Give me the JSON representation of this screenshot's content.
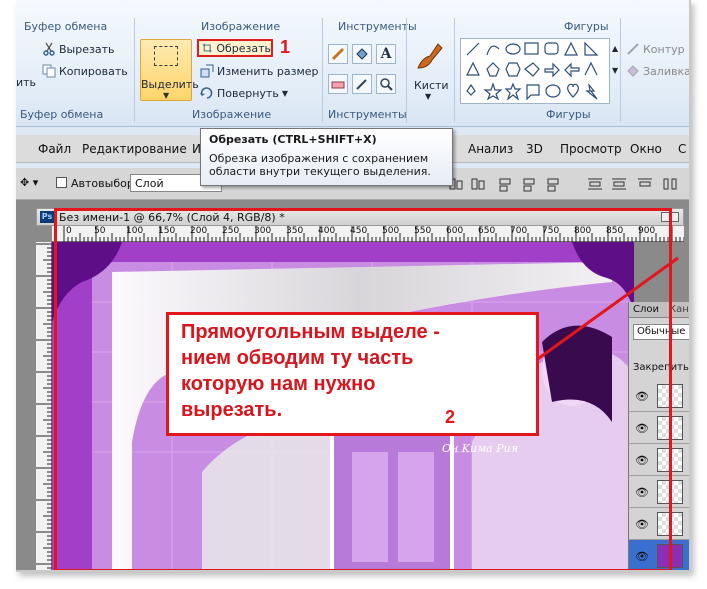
{
  "ribbon": {
    "groups": {
      "clipboard": "Буфер обмена",
      "image": "Изображение",
      "tools": "Инструменты",
      "shapes": "Фигуры"
    },
    "paste_partial": "ить",
    "cut_label": "Вырезать",
    "copy_label": "Копировать",
    "select_label": "Выделить",
    "crop_label": "Обрезать",
    "resize_label": "Изменить размер",
    "rotate_label": "Повернуть",
    "brushes_label": "Кисти",
    "outline_label": "Контур",
    "fill_label": "Заливка",
    "marker_1": "1"
  },
  "tooltip": {
    "title": "Обрезать (CTRL+SHIFT+X)",
    "line1": "Обрезка изображения с сохранением",
    "line2": "области внутри текущего выделения."
  },
  "menubar": {
    "items": [
      "Файл",
      "Редактирование",
      "И",
      "Анализ",
      "3D",
      "Просмотр",
      "Окно",
      "С"
    ]
  },
  "options": {
    "autoselect_label": "Автовыбор:",
    "autoselect_value": "Слой"
  },
  "document": {
    "title": "Без имени-1 @ 66,7% (Слой 4, RGB/8) *",
    "ps_badge": "Ps",
    "ruler_ticks": [
      "0",
      "50",
      "100",
      "150",
      "200",
      "250",
      "300",
      "350",
      "400",
      "450",
      "500",
      "550",
      "600",
      "650",
      "700",
      "750",
      "800",
      "850",
      "900"
    ],
    "signature": "Он Kима Рия"
  },
  "callout": {
    "line1": "Прямоугольным выделе -",
    "line2": "нием обводим ту часть",
    "line3": "которую  нам нужно",
    "line4": "вырезать.",
    "marker_2": "2"
  },
  "layers_panel": {
    "tab1": "Слои",
    "tab2": "Кана",
    "blend_mode": "Обычные",
    "lock_label": "Закрепить:"
  },
  "colors": {
    "accent_red": "#e3161b",
    "ribbon_bg": "#e3edf8",
    "canvas_purple": "#9c3cc2"
  }
}
